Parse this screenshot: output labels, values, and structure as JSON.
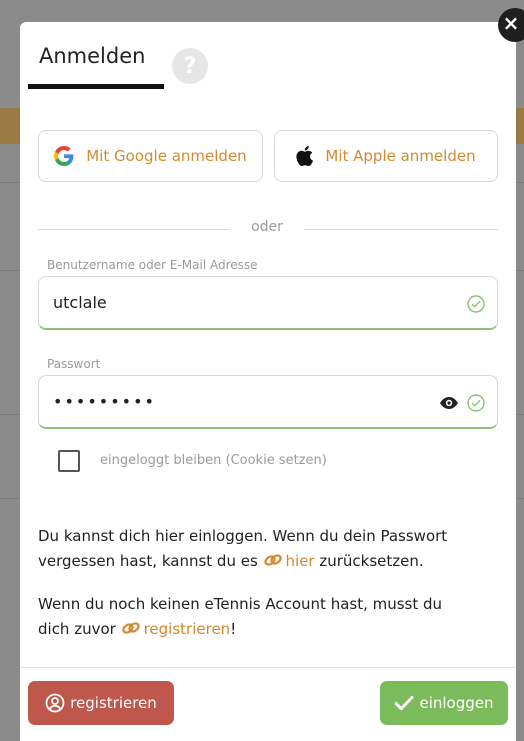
{
  "modal": {
    "title": "Anmelden",
    "close_glyph": "×",
    "help_glyph": "?"
  },
  "social": {
    "google_label": "Mit Google anmelden",
    "apple_label": "Mit Apple anmelden"
  },
  "divider_text": "oder",
  "form": {
    "username_label": "Benutzername oder E-Mail Adresse",
    "username_value": "utclale",
    "password_label": "Passwort",
    "password_value": "•••••••••",
    "remember_label": "eingeloggt bleiben (Cookie setzen)"
  },
  "info": {
    "line1_prefix": "Du kannst dich hier einloggen. Wenn du dein Passwort vergessen hast, kannst du es ",
    "forgot_link": "hier",
    "line1_suffix": " zurücksetzen.",
    "line2_prefix": "Wenn du noch keinen eTennis Account hast, musst du dich zuvor ",
    "register_link": "registrieren",
    "line2_suffix": "!"
  },
  "footer": {
    "register_label": "registrieren",
    "login_label": "einloggen"
  },
  "colors": {
    "accent": "#d4892e",
    "success": "#7cbb5c",
    "danger": "#c0574c"
  }
}
